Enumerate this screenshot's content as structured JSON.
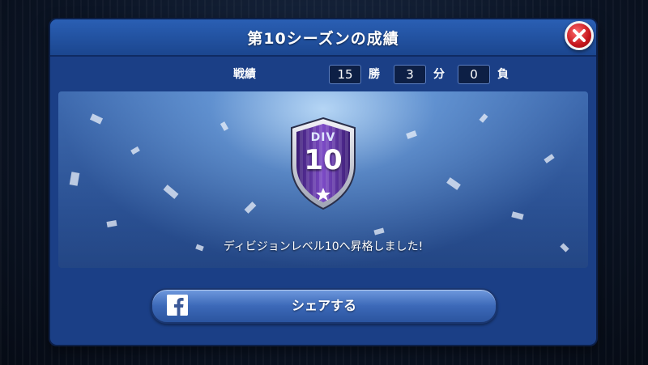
{
  "dialog": {
    "title": "第10シーズンの成績"
  },
  "record": {
    "label": "戦績",
    "wins": "15",
    "wins_unit": "勝",
    "draws": "3",
    "draws_unit": "分",
    "losses": "0",
    "losses_unit": "負"
  },
  "badge": {
    "div_label": "DIV",
    "level": "10",
    "icon": "division-shield-icon"
  },
  "promotion": {
    "message": "ディビジョンレベル10へ昇格しました!"
  },
  "share": {
    "label": "シェアする",
    "icon": "facebook-icon"
  },
  "close": {
    "icon": "close-icon"
  },
  "colors": {
    "dialog_blue": "#1b3f86",
    "close_red": "#c5151c",
    "badge_purple": "#5b2fa0"
  }
}
